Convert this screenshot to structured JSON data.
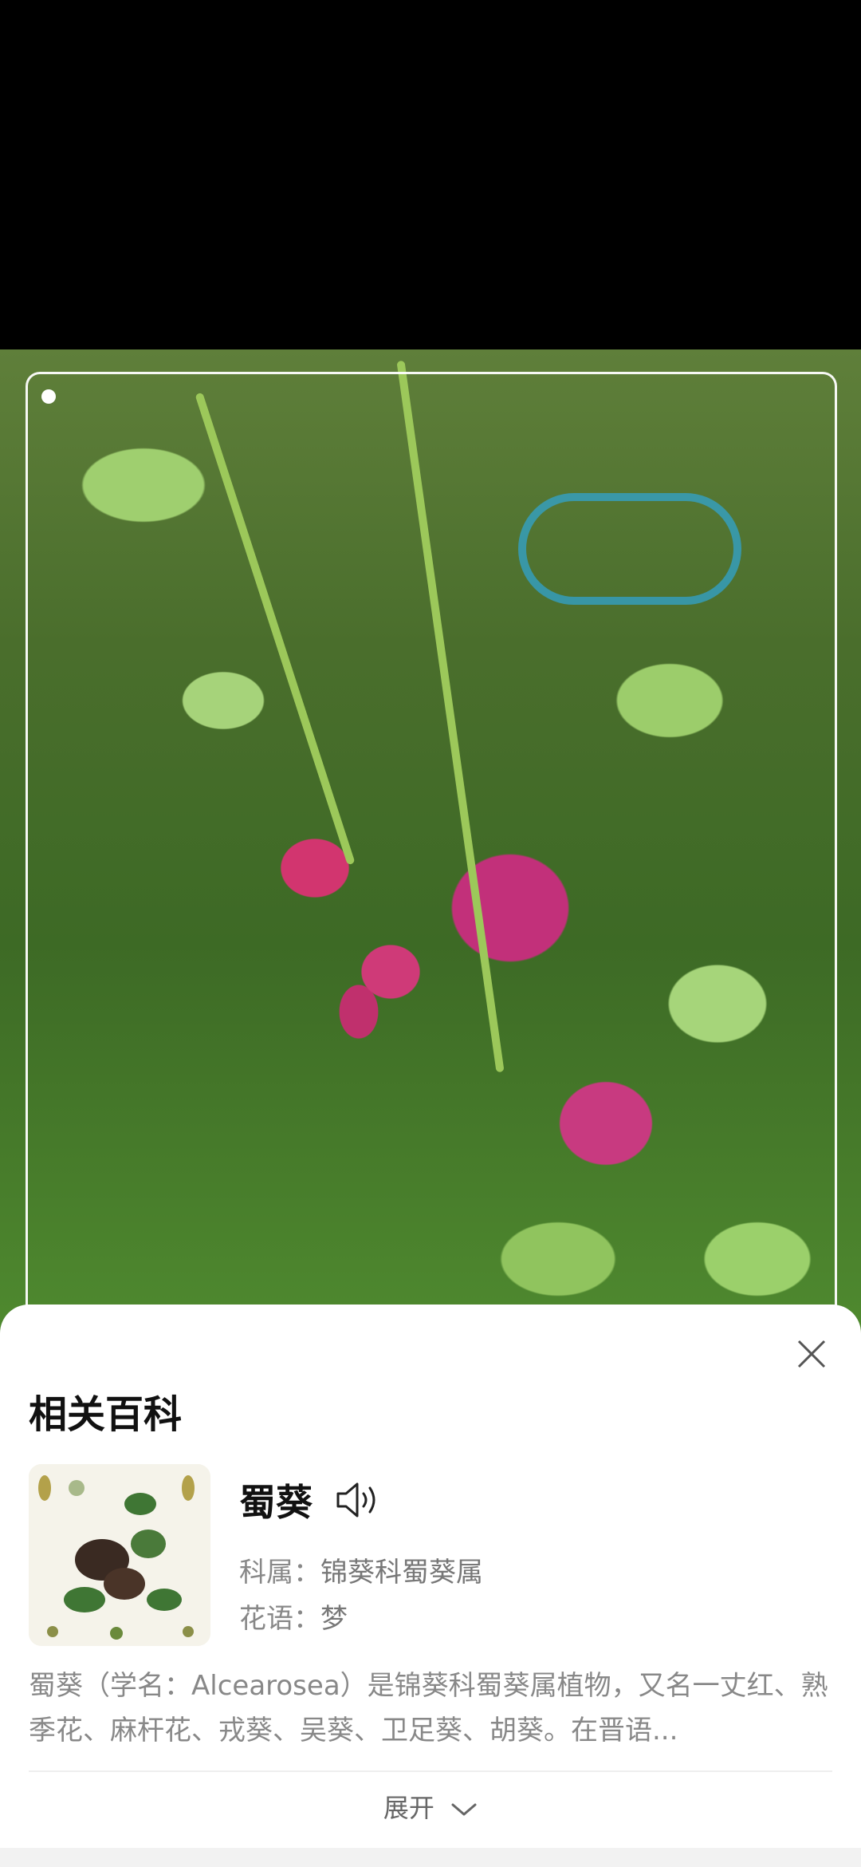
{
  "sheet": {
    "section_title": "相关百科",
    "plant": {
      "name": "蜀葵",
      "family_label": "科属：",
      "family_value": "锦葵科蜀葵属",
      "flower_language_label": "花语：",
      "flower_language_value": "梦"
    },
    "description": "蜀葵（学名：Alcearosea）是锦葵科蜀葵属植物，又名一丈红、熟季花、麻杆花、戎葵、吴葵、卫足葵、胡葵。在晋语...",
    "expand_label": "展开"
  },
  "icons": {
    "close": "close-icon",
    "speaker": "speaker-icon",
    "expand": "chevron-down-icon"
  },
  "colors": {
    "sheet_bg": "#ffffff",
    "title": "#111111",
    "secondary_text": "#888888"
  }
}
